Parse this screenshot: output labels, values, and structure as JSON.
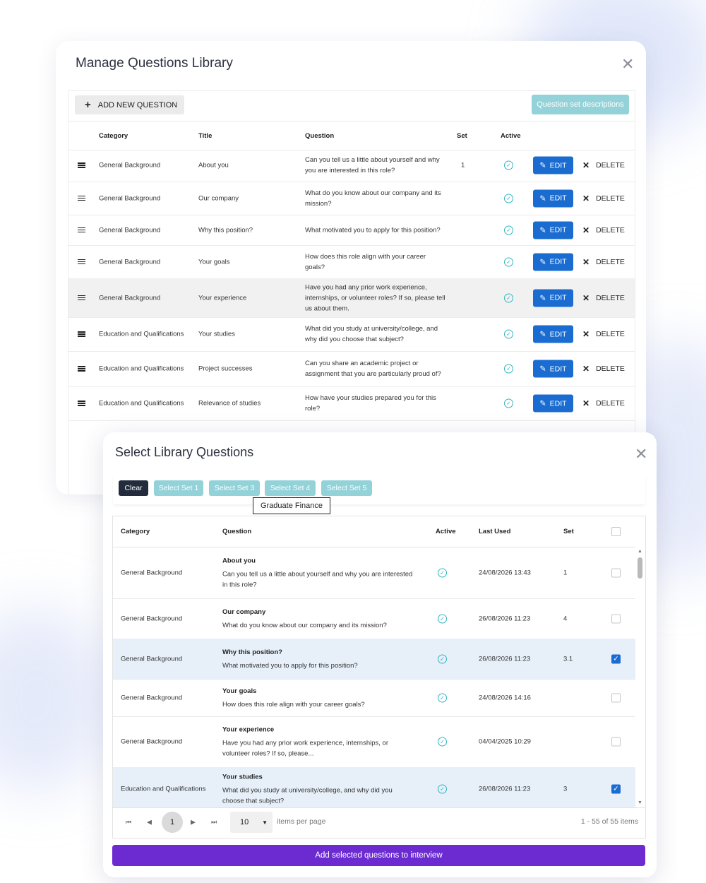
{
  "manage_dialog": {
    "title": "Manage Questions Library",
    "close_icon": "close-icon",
    "add_new_label": "ADD NEW QUESTION",
    "question_set_descriptions_label": "Question set descriptions",
    "columns": {
      "category": "Category",
      "title": "Title",
      "question": "Question",
      "set": "Set",
      "active": "Active"
    },
    "edit_label": "EDIT",
    "delete_label": "DELETE",
    "rows": [
      {
        "category": "General Background",
        "title": "About you",
        "question": "Can you tell us a little about yourself and why you are interested in this role?",
        "set": "1",
        "highlighted": false
      },
      {
        "category": "General Background",
        "title": "Our company",
        "question": "What do you know about our company and its mission?",
        "set": "",
        "highlighted": false
      },
      {
        "category": "General Background",
        "title": "Why this position?",
        "question": "What motivated you to apply for this position?",
        "set": "",
        "highlighted": false
      },
      {
        "category": "General Background",
        "title": "Your goals",
        "question": "How does this role align with your career goals?",
        "set": "",
        "highlighted": false
      },
      {
        "category": "General Background",
        "title": "Your experience",
        "question": "Have you had any prior work experience, internships, or volunteer roles? If so, please tell us about them.",
        "set": "",
        "highlighted": true
      },
      {
        "category": "Education and Qualifications",
        "title": "Your studies",
        "question": "What did you study at university/college, and why did you choose that subject?",
        "set": "",
        "highlighted": false
      },
      {
        "category": "Education and Qualifications",
        "title": "Project successes",
        "question": "Can you share an academic project or assignment that you are particularly proud of?",
        "set": "",
        "highlighted": false
      },
      {
        "category": "Education and Qualifications",
        "title": "Relevance of studies",
        "question": "How have your studies prepared you for this role?",
        "set": "",
        "highlighted": false
      }
    ]
  },
  "select_dialog": {
    "title": "Select Library Questions",
    "close_icon": "close-icon",
    "buttons": {
      "clear": "Clear",
      "set1": "Select Set 1",
      "set3": "Select Set 3",
      "set4": "Select Set 4",
      "set5": "Select Set 5"
    },
    "tooltip": "Graduate Finance",
    "columns": {
      "category": "Category",
      "question": "Question",
      "active": "Active",
      "last_used": "Last Used",
      "set": "Set"
    },
    "rows": [
      {
        "category": "General Background",
        "title": "About you",
        "question": "Can you tell us a little about yourself and why you are interested in this role?",
        "last_used": "24/08/2026 13:43",
        "set": "1",
        "checked": false
      },
      {
        "category": "General Background",
        "title": "Our company",
        "question": "What do you know about our company and its mission?",
        "last_used": "26/08/2026 11:23",
        "set": "4",
        "checked": false
      },
      {
        "category": "General Background",
        "title": "Why this position?",
        "question": "What motivated you to apply for this position?",
        "last_used": "26/08/2026 11:23",
        "set": "3.1",
        "checked": true
      },
      {
        "category": "General Background",
        "title": "Your goals",
        "question": "How does this role align with your career goals?",
        "last_used": "24/08/2026 14:16",
        "set": "",
        "checked": false
      },
      {
        "category": "General Background",
        "title": "Your experience",
        "question": "Have you had any prior work experience, internships, or volunteer roles? If so, please...",
        "last_used": "04/04/2025 10:29",
        "set": "",
        "checked": false
      },
      {
        "category": "Education and Qualifications",
        "title": "Your studies",
        "question": "What did you study at university/college, and why did you choose that subject?",
        "last_used": "26/08/2026 11:23",
        "set": "3",
        "checked": true
      }
    ],
    "pagination": {
      "current_page": "1",
      "page_size": "10",
      "items_per_page_label": "items per page",
      "count_label": "1 - 55 of 55 items"
    },
    "submit_label": "Add selected questions to interview"
  }
}
